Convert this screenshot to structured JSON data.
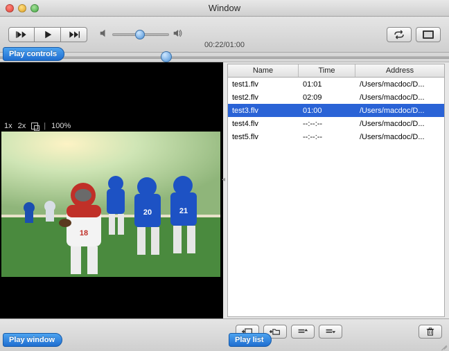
{
  "window": {
    "title": "Window"
  },
  "toolbar": {
    "time_display": "00:22/01:00",
    "volume_position_pct": 48,
    "scrub_position_pct": 37
  },
  "tags": {
    "play_controls": "Play controls",
    "play_window": "Play window",
    "play_list": "Play list"
  },
  "video_overlay": {
    "speed1": "1x",
    "speed2": "2x",
    "zoom": "100%"
  },
  "playlist": {
    "columns": {
      "name": "Name",
      "time": "Time",
      "address": "Address"
    },
    "rows": [
      {
        "name": "test1.flv",
        "time": "01:01",
        "address": "/Users/macdoc/D...",
        "selected": false
      },
      {
        "name": "test2.flv",
        "time": "02:09",
        "address": "/Users/macdoc/D...",
        "selected": false
      },
      {
        "name": "test3.flv",
        "time": "01:00",
        "address": "/Users/macdoc/D...",
        "selected": true
      },
      {
        "name": "test4.flv",
        "time": "--:--:--",
        "address": "/Users/macdoc/D...",
        "selected": false
      },
      {
        "name": "test5.flv",
        "time": "--:--:--",
        "address": "/Users/macdoc/D...",
        "selected": false
      }
    ]
  },
  "icons": {
    "prev": "prev-icon",
    "play": "play-icon",
    "next": "next-icon",
    "loop": "loop-icon",
    "fullscreen": "fullscreen-icon",
    "add_file": "add-file-icon",
    "add_folder": "add-folder-icon",
    "move_up": "move-up-icon",
    "move_down": "move-down-icon",
    "trash": "trash-icon",
    "speaker_low": "speaker-low-icon",
    "speaker_high": "speaker-high-icon",
    "expand": "expand-icon"
  }
}
